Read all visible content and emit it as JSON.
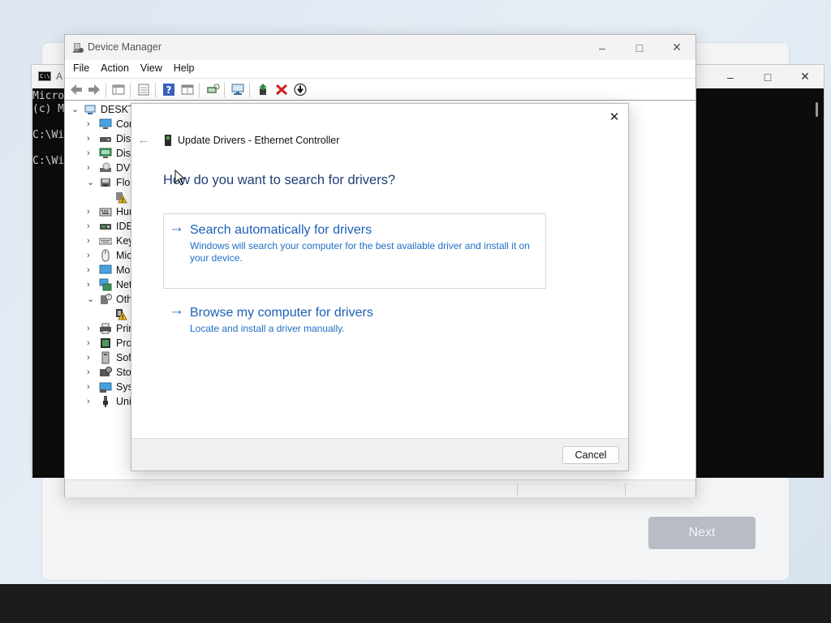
{
  "desktop": {
    "setup": {
      "next_label": "Next"
    }
  },
  "cmd_window": {
    "title": "A",
    "icon_text": "C:\\",
    "lines": [
      "Micro",
      "(c) M",
      "",
      "C:\\Wi",
      "",
      "C:\\Wi"
    ]
  },
  "device_manager": {
    "title": "Device Manager",
    "menu": [
      "File",
      "Action",
      "View",
      "Help"
    ],
    "toolbar_icons": [
      "back-arrow-icon",
      "forward-arrow-icon",
      "properties-grid-icon",
      "properties-sheet-icon",
      "help-icon",
      "view-grid-icon",
      "scan-hardware-icon",
      "monitor-network-icon",
      "update-driver-icon",
      "uninstall-x-icon",
      "disable-device-icon"
    ],
    "tree": [
      {
        "label": "DESKTO",
        "expanded": true,
        "icon": "computer-icon"
      },
      {
        "label": "Cor",
        "icon": "monitor-icon"
      },
      {
        "label": "Disk",
        "icon": "disk-drive-icon"
      },
      {
        "label": "Disp",
        "icon": "display-adapter-icon"
      },
      {
        "label": "DVD",
        "icon": "dvd-drive-icon"
      },
      {
        "label": "Flop",
        "expanded": true,
        "icon": "floppy-controller-icon"
      },
      {
        "label": "",
        "icon": "warning-device-icon"
      },
      {
        "label": "Hur",
        "icon": "hid-icon"
      },
      {
        "label": "IDE",
        "icon": "ide-controller-icon"
      },
      {
        "label": "Key",
        "icon": "keyboard-icon"
      },
      {
        "label": "Mic",
        "icon": "mouse-icon"
      },
      {
        "label": "Mo",
        "icon": "monitors-icon"
      },
      {
        "label": "Net",
        "icon": "network-adapter-icon"
      },
      {
        "label": "Oth",
        "expanded": true,
        "icon": "other-devices-icon"
      },
      {
        "label": "",
        "icon": "warning-device-icon"
      },
      {
        "label": "Prir",
        "icon": "print-queue-icon"
      },
      {
        "label": "Pro",
        "icon": "processor-icon"
      },
      {
        "label": "Soft",
        "icon": "software-device-icon"
      },
      {
        "label": "Stor",
        "icon": "storage-controller-icon"
      },
      {
        "label": "Syst",
        "icon": "system-device-icon"
      },
      {
        "label": "Uni",
        "icon": "usb-icon"
      }
    ]
  },
  "update_dialog": {
    "title": "Update Drivers - Ethernet Controller",
    "heading": "How do you want to search for drivers?",
    "options": [
      {
        "title": "Search automatically for drivers",
        "description": "Windows will search your computer for the best available driver and install it on your device."
      },
      {
        "title": "Browse my computer for drivers",
        "description": "Locate and install a driver manually."
      }
    ],
    "cancel_label": "Cancel"
  }
}
